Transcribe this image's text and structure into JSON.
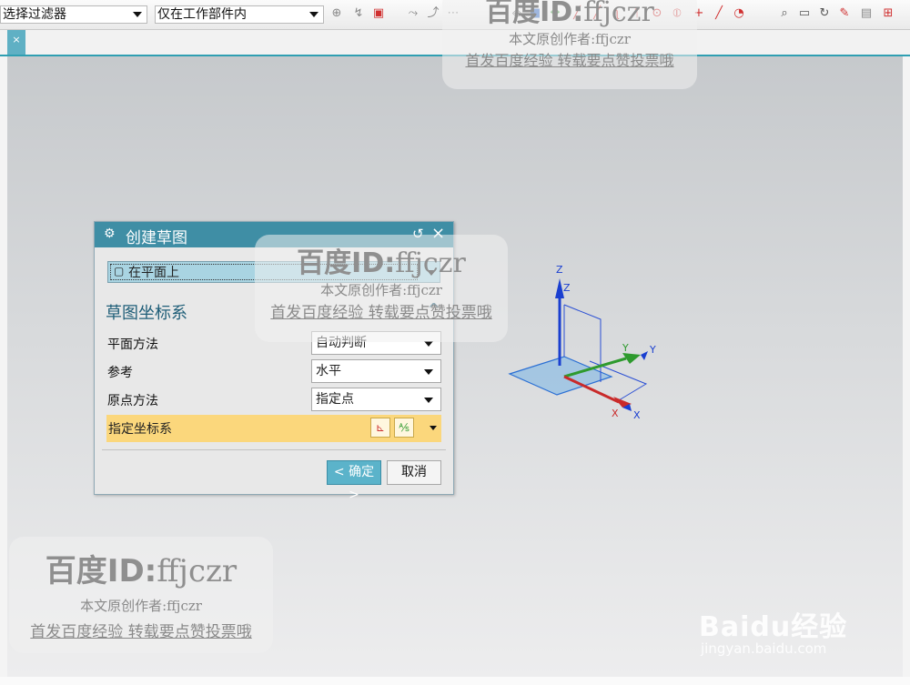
{
  "toolbar": {
    "selection_filter": "选择过滤器",
    "scope_filter": "仅在工作部件内",
    "icons": [
      "snap-icon",
      "snap-point-icon",
      "snap-dropdown-icon",
      "curve-icon",
      "face-icon",
      "feature-icon",
      "box-icon",
      "solid-icon",
      "vertex-icon",
      "line-end-icon",
      "line-mid-icon",
      "arc-icon",
      "intersection-icon",
      "circle-center-icon",
      "quadrant-icon",
      "point-on-curve-icon",
      "line-icon",
      "gear-point-icon",
      "zoom-icon",
      "fit-icon",
      "rotate-icon",
      "paint-icon",
      "layer-icon",
      "grid-icon"
    ]
  },
  "tab": {
    "close_label": "×"
  },
  "dialog": {
    "title": "创建草图",
    "type_value": "在平面上",
    "section_title": "草图坐标系",
    "plane_method_label": "平面方法",
    "plane_method_value": "自动判断",
    "reference_label": "参考",
    "reference_value": "水平",
    "origin_method_label": "原点方法",
    "origin_method_value": "指定点",
    "specify_csys_label": "指定坐标系",
    "ok_label": "< 确定 >",
    "cancel_label": "取消"
  },
  "csys": {
    "z_label_1": "Z",
    "z_label_2": "Z",
    "y_label_1": "Y",
    "y_label_2": "Y",
    "x_label_1": "X",
    "x_label_2": "X"
  },
  "watermarks": {
    "brand": "百度ID:",
    "brand_id": "ffjczr",
    "author_line": "本文原创作者:ffjczr",
    "publish_line": "首发百度经验 转载要点赞投票哦"
  },
  "baidu_logo": {
    "main": "Baidu经验",
    "sub": "jingyan.baidu.com"
  },
  "colors": {
    "accent": "#3f8ea5",
    "highlight_row": "#fbd77c",
    "selected": "#a9d4e2"
  }
}
